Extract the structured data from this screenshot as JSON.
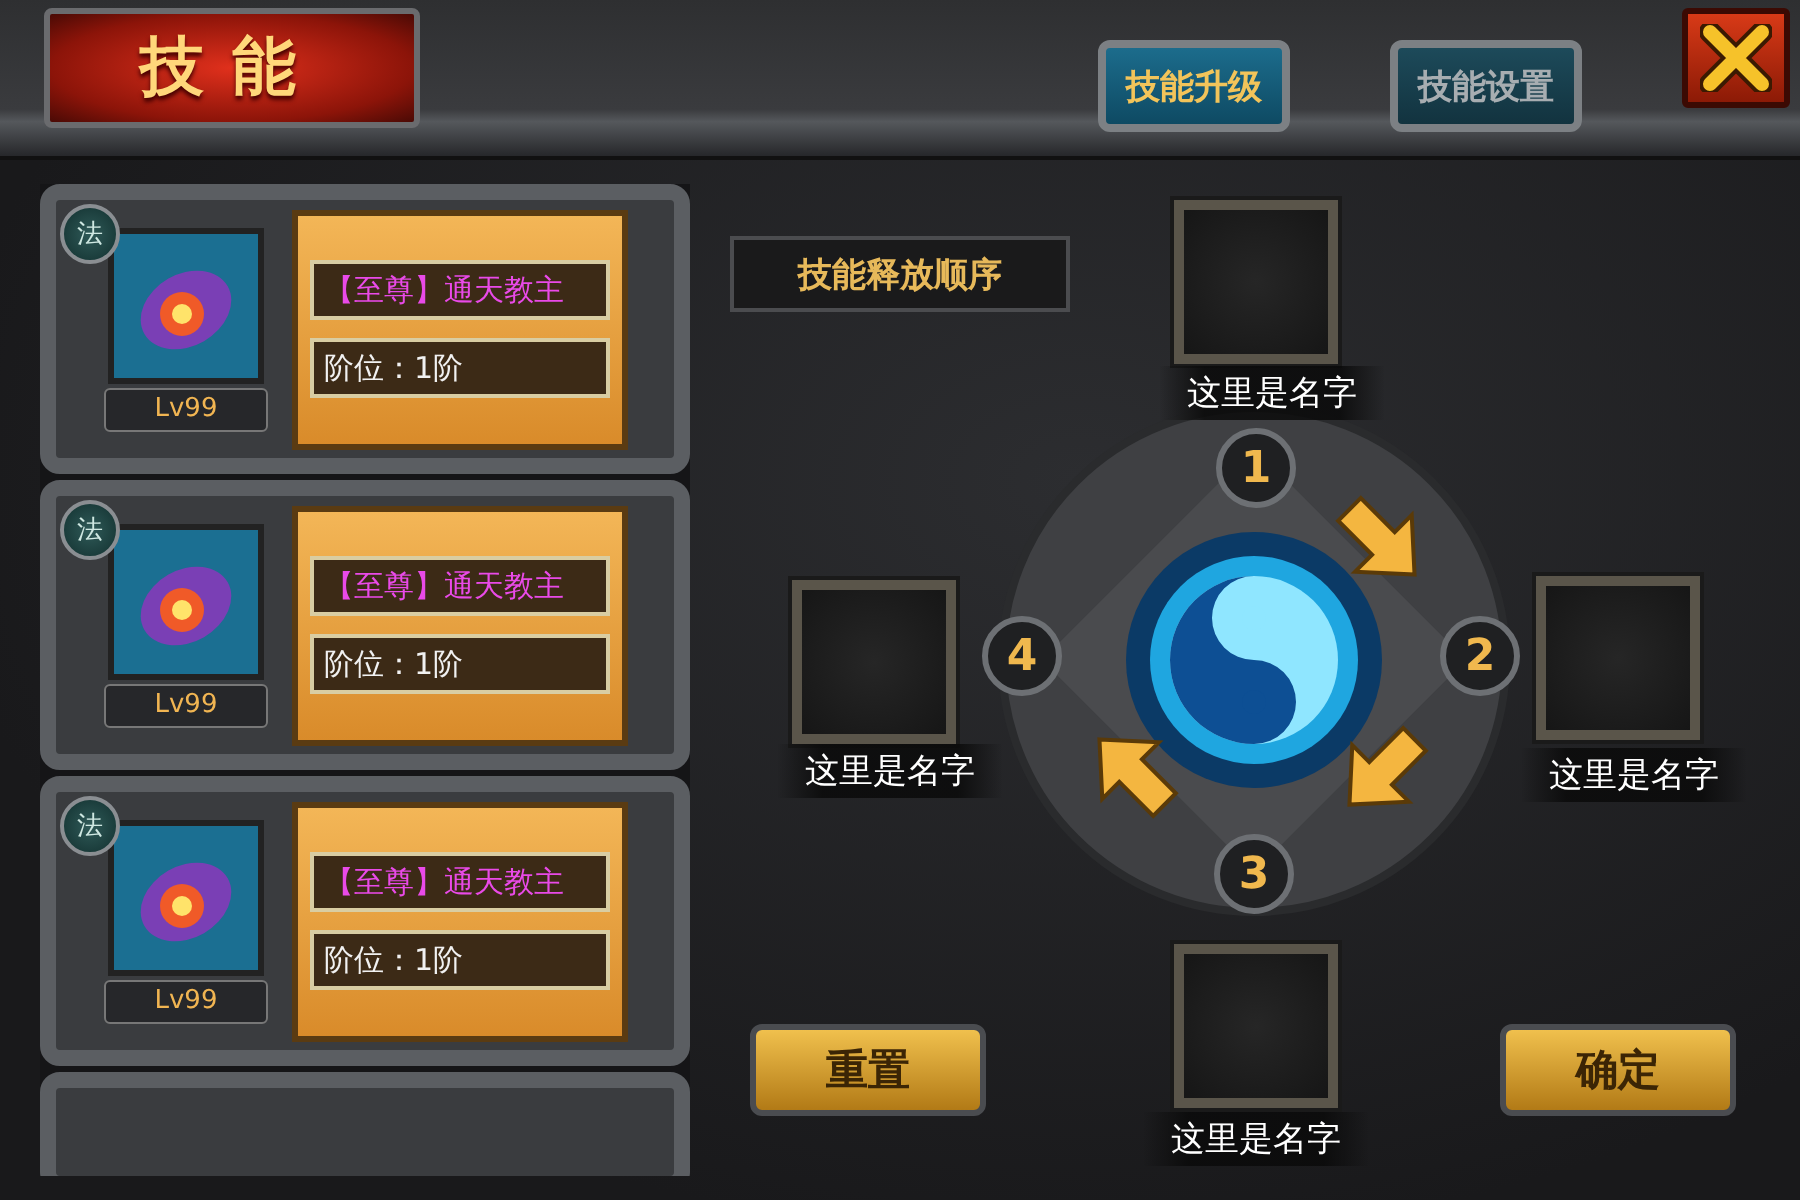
{
  "header": {
    "title": "技能"
  },
  "tabs": [
    {
      "label": "技能升级",
      "selected": true
    },
    {
      "label": "技能设置",
      "selected": false
    }
  ],
  "skills": [
    {
      "badge": "法",
      "level": "Lv99",
      "name": "【至尊】通天教主",
      "rank": "阶位：1阶"
    },
    {
      "badge": "法",
      "level": "Lv99",
      "name": "【至尊】通天教主",
      "rank": "阶位：1阶"
    },
    {
      "badge": "法",
      "level": "Lv99",
      "name": "【至尊】通天教主",
      "rank": "阶位：1阶"
    }
  ],
  "order_panel": {
    "title": "技能释放顺序",
    "slots": [
      {
        "number": "1",
        "name": "这里是名字"
      },
      {
        "number": "2",
        "name": "这里是名字"
      },
      {
        "number": "3",
        "name": "这里是名字"
      },
      {
        "number": "4",
        "name": "这里是名字"
      }
    ]
  },
  "buttons": [
    {
      "label": "重置"
    },
    {
      "label": "确定"
    }
  ]
}
